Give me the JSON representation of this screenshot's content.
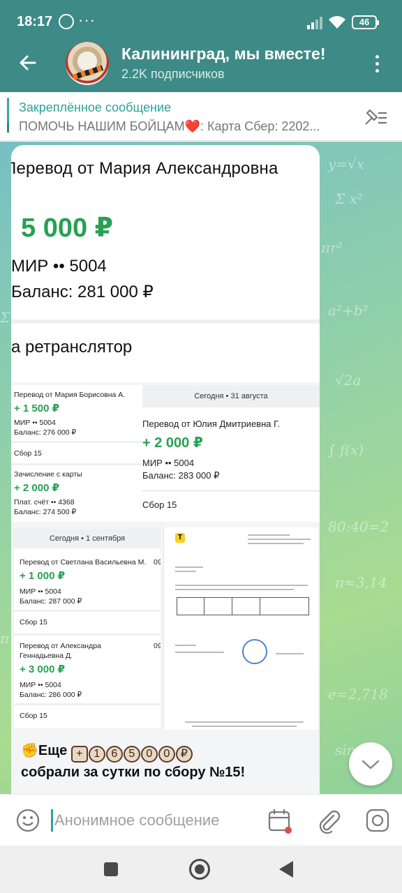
{
  "status_bar": {
    "time": "18:17",
    "battery": "46"
  },
  "header": {
    "title": "Калининград, мы вместе!",
    "subtitle": "2.2K подписчиков"
  },
  "pinned": {
    "label": "Закреплённое сообщение",
    "text": "ПОМОЧЬ НАШИМ БОЙЦАМ❤️:  Карта Сбер: 2202..."
  },
  "receipt_main": {
    "title": "Перевод от Мария Александровна",
    "amount": "5 000 ₽",
    "card": "МИР •• 5004",
    "balance": "Баланс: 281 000 ₽",
    "category": "а ретранслятор"
  },
  "receipt_left": {
    "t1_title": "Перевод от Мария Борисовна А.",
    "t1_amount": "+ 1 500 ₽",
    "t1_card": "МИР •• 5004",
    "t1_balance": "Баланс: 276 000 ₽",
    "t1_cat": "Сбор 15",
    "t2_title": "Зачисление с карты",
    "t2_amount": "+ 2 000 ₽",
    "t2_card": "Плат. счёт •• 4368",
    "t2_balance": "Баланс: 274 500 ₽"
  },
  "receipt_right": {
    "date": "Сегодня • 31 августа",
    "title": "Перевод от Юлия Дмитриевна Г.",
    "amount": "+ 2 000 ₽",
    "card": "МИР •• 5004",
    "balance": "Баланс: 283 000 ₽",
    "cat": "Сбор 15"
  },
  "receipt_sept": {
    "date": "Сегодня • 1 сентября",
    "t1_title": "Перевод от Светлана Васильевна М.",
    "t1_time": "09",
    "t1_amount": "+ 1 000 ₽",
    "t1_card": "МИР •• 5004",
    "t1_balance": "Баланс: 287 000 ₽",
    "t1_cat": "Сбор 15",
    "t2_title_1": "Перевод от Александра",
    "t2_title_2": "Геннадьевна Д.",
    "t2_time": "09",
    "t2_amount": "+ 3 000 ₽",
    "t2_card": "МИР •• 5004",
    "t2_balance": "Баланс: 286 000 ₽",
    "t2_cat": "Сбор 15"
  },
  "caption": {
    "line1_prefix": "✊Еще",
    "digits": [
      "+",
      "1",
      "6",
      "5",
      "0",
      "0",
      "₽"
    ],
    "line2": "собрали за сутки по сбору №15!"
  },
  "input": {
    "placeholder": "Анонимное сообщение"
  },
  "colors": {
    "header": "#3e8a86",
    "accent": "#2aa39a",
    "money_green": "#27a053"
  },
  "icons": [
    "back-arrow-icon",
    "more-vert-icon",
    "unpin-icon",
    "scroll-down-icon",
    "emoji-icon",
    "schedule-icon",
    "attach-icon",
    "camera-icon"
  ]
}
